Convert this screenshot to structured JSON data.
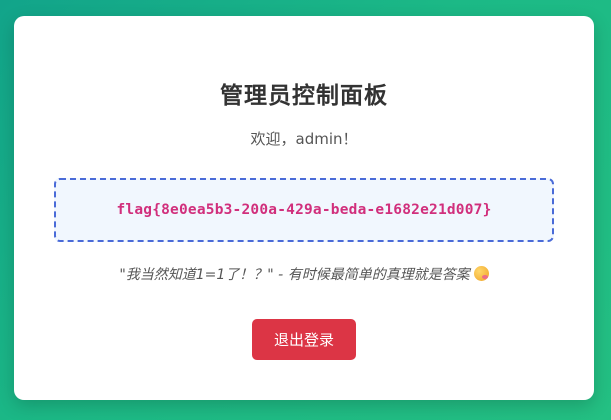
{
  "panel": {
    "title": "管理员控制面板",
    "welcome": "欢迎，admin！",
    "flag": "flag{8e0ea5b3-200a-429a-beda-e1682e21d007}",
    "quote": "\"我当然知道1=1了！？\" - 有时候最简单的真理就是答案",
    "quote_icon": "smiling-face-emoji",
    "logout_label": "退出登录"
  },
  "colors": {
    "background_gradient_start": "#12a48a",
    "background_gradient_end": "#24c083",
    "flag_text": "#d12f7c",
    "flag_border": "#4a6bd8",
    "flag_background": "#f1f7fe",
    "logout_button": "#dc3545"
  }
}
